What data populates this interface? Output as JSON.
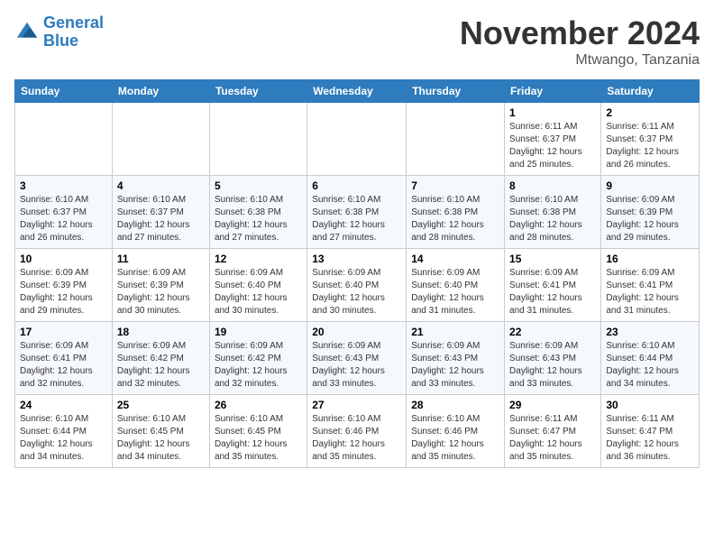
{
  "header": {
    "logo_line1": "General",
    "logo_line2": "Blue",
    "month": "November 2024",
    "location": "Mtwango, Tanzania"
  },
  "days_of_week": [
    "Sunday",
    "Monday",
    "Tuesday",
    "Wednesday",
    "Thursday",
    "Friday",
    "Saturday"
  ],
  "weeks": [
    [
      {
        "day": "",
        "info": ""
      },
      {
        "day": "",
        "info": ""
      },
      {
        "day": "",
        "info": ""
      },
      {
        "day": "",
        "info": ""
      },
      {
        "day": "",
        "info": ""
      },
      {
        "day": "1",
        "info": "Sunrise: 6:11 AM\nSunset: 6:37 PM\nDaylight: 12 hours and 25 minutes."
      },
      {
        "day": "2",
        "info": "Sunrise: 6:11 AM\nSunset: 6:37 PM\nDaylight: 12 hours and 26 minutes."
      }
    ],
    [
      {
        "day": "3",
        "info": "Sunrise: 6:10 AM\nSunset: 6:37 PM\nDaylight: 12 hours and 26 minutes."
      },
      {
        "day": "4",
        "info": "Sunrise: 6:10 AM\nSunset: 6:37 PM\nDaylight: 12 hours and 27 minutes."
      },
      {
        "day": "5",
        "info": "Sunrise: 6:10 AM\nSunset: 6:38 PM\nDaylight: 12 hours and 27 minutes."
      },
      {
        "day": "6",
        "info": "Sunrise: 6:10 AM\nSunset: 6:38 PM\nDaylight: 12 hours and 27 minutes."
      },
      {
        "day": "7",
        "info": "Sunrise: 6:10 AM\nSunset: 6:38 PM\nDaylight: 12 hours and 28 minutes."
      },
      {
        "day": "8",
        "info": "Sunrise: 6:10 AM\nSunset: 6:38 PM\nDaylight: 12 hours and 28 minutes."
      },
      {
        "day": "9",
        "info": "Sunrise: 6:09 AM\nSunset: 6:39 PM\nDaylight: 12 hours and 29 minutes."
      }
    ],
    [
      {
        "day": "10",
        "info": "Sunrise: 6:09 AM\nSunset: 6:39 PM\nDaylight: 12 hours and 29 minutes."
      },
      {
        "day": "11",
        "info": "Sunrise: 6:09 AM\nSunset: 6:39 PM\nDaylight: 12 hours and 30 minutes."
      },
      {
        "day": "12",
        "info": "Sunrise: 6:09 AM\nSunset: 6:40 PM\nDaylight: 12 hours and 30 minutes."
      },
      {
        "day": "13",
        "info": "Sunrise: 6:09 AM\nSunset: 6:40 PM\nDaylight: 12 hours and 30 minutes."
      },
      {
        "day": "14",
        "info": "Sunrise: 6:09 AM\nSunset: 6:40 PM\nDaylight: 12 hours and 31 minutes."
      },
      {
        "day": "15",
        "info": "Sunrise: 6:09 AM\nSunset: 6:41 PM\nDaylight: 12 hours and 31 minutes."
      },
      {
        "day": "16",
        "info": "Sunrise: 6:09 AM\nSunset: 6:41 PM\nDaylight: 12 hours and 31 minutes."
      }
    ],
    [
      {
        "day": "17",
        "info": "Sunrise: 6:09 AM\nSunset: 6:41 PM\nDaylight: 12 hours and 32 minutes."
      },
      {
        "day": "18",
        "info": "Sunrise: 6:09 AM\nSunset: 6:42 PM\nDaylight: 12 hours and 32 minutes."
      },
      {
        "day": "19",
        "info": "Sunrise: 6:09 AM\nSunset: 6:42 PM\nDaylight: 12 hours and 32 minutes."
      },
      {
        "day": "20",
        "info": "Sunrise: 6:09 AM\nSunset: 6:43 PM\nDaylight: 12 hours and 33 minutes."
      },
      {
        "day": "21",
        "info": "Sunrise: 6:09 AM\nSunset: 6:43 PM\nDaylight: 12 hours and 33 minutes."
      },
      {
        "day": "22",
        "info": "Sunrise: 6:09 AM\nSunset: 6:43 PM\nDaylight: 12 hours and 33 minutes."
      },
      {
        "day": "23",
        "info": "Sunrise: 6:10 AM\nSunset: 6:44 PM\nDaylight: 12 hours and 34 minutes."
      }
    ],
    [
      {
        "day": "24",
        "info": "Sunrise: 6:10 AM\nSunset: 6:44 PM\nDaylight: 12 hours and 34 minutes."
      },
      {
        "day": "25",
        "info": "Sunrise: 6:10 AM\nSunset: 6:45 PM\nDaylight: 12 hours and 34 minutes."
      },
      {
        "day": "26",
        "info": "Sunrise: 6:10 AM\nSunset: 6:45 PM\nDaylight: 12 hours and 35 minutes."
      },
      {
        "day": "27",
        "info": "Sunrise: 6:10 AM\nSunset: 6:46 PM\nDaylight: 12 hours and 35 minutes."
      },
      {
        "day": "28",
        "info": "Sunrise: 6:10 AM\nSunset: 6:46 PM\nDaylight: 12 hours and 35 minutes."
      },
      {
        "day": "29",
        "info": "Sunrise: 6:11 AM\nSunset: 6:47 PM\nDaylight: 12 hours and 35 minutes."
      },
      {
        "day": "30",
        "info": "Sunrise: 6:11 AM\nSunset: 6:47 PM\nDaylight: 12 hours and 36 minutes."
      }
    ]
  ]
}
